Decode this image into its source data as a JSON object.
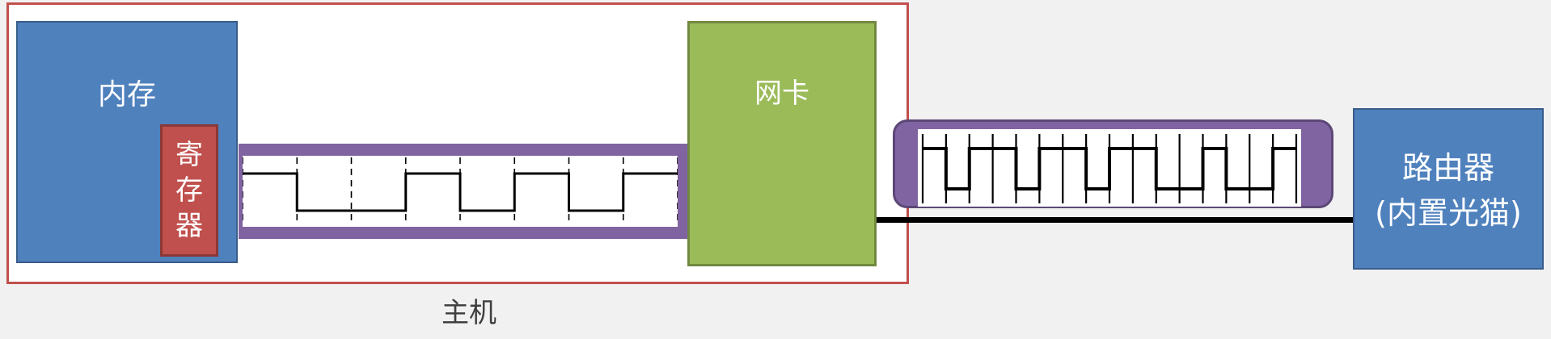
{
  "host": {
    "label": "主机"
  },
  "memory": {
    "label": "内存"
  },
  "register": {
    "label": "寄\n存\n器"
  },
  "nic": {
    "label": "网卡"
  },
  "router": {
    "label": "路由器\n(内置光猫)"
  },
  "colors": {
    "memory": "#4f81bd",
    "register": "#c0504d",
    "nic": "#9bbb59",
    "bus": "#8064a2",
    "router": "#4f81bd",
    "host_border": "#c0504d"
  },
  "signals": {
    "internal_bits": [
      1,
      0,
      0,
      1,
      0,
      1,
      0,
      1
    ],
    "external_bits": [
      1,
      0,
      1,
      1,
      0,
      1,
      1,
      0,
      1,
      1,
      0,
      0,
      1,
      0,
      0,
      1
    ]
  }
}
